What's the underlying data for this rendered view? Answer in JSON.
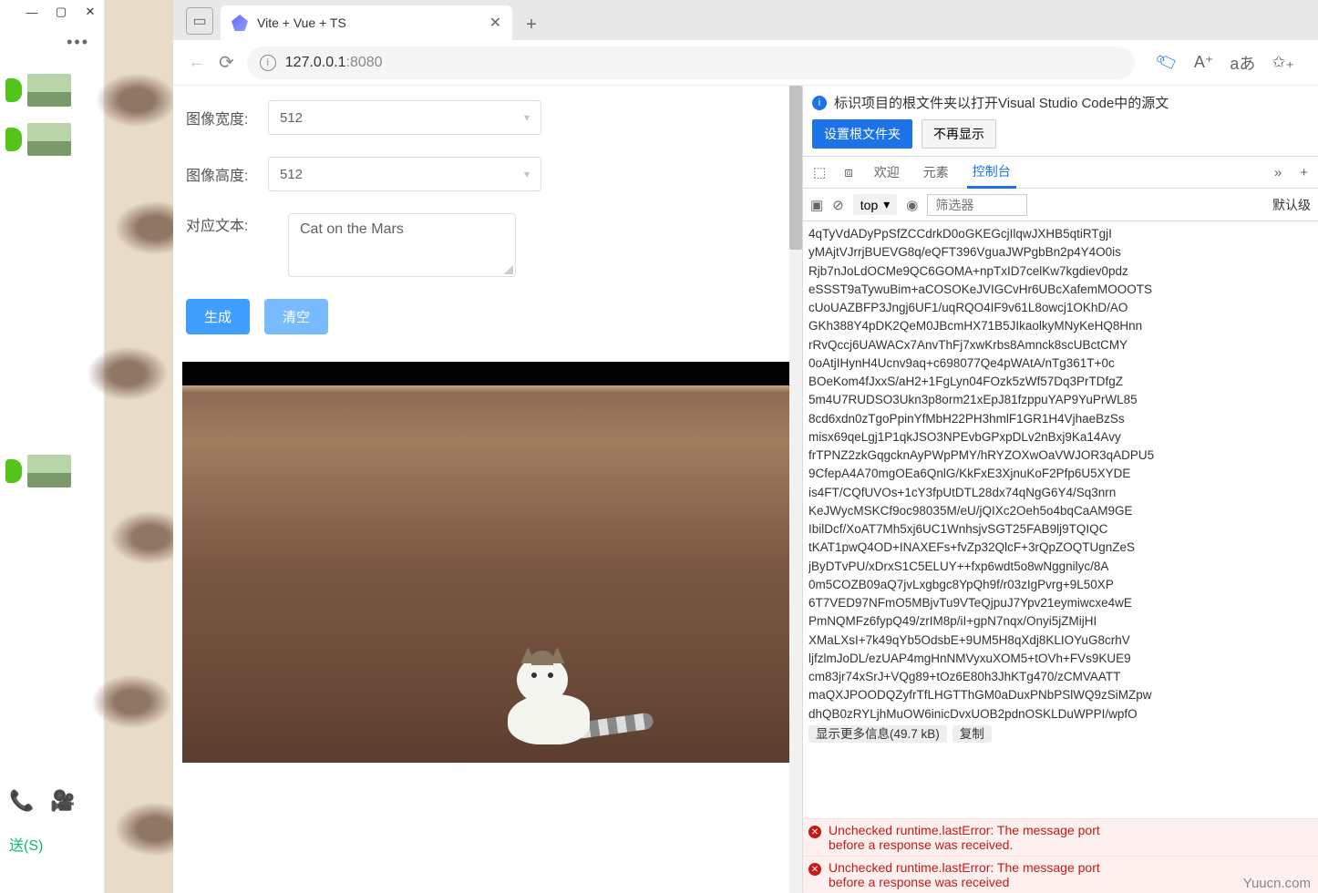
{
  "leftPanel": {
    "dotsMenu": "•••",
    "sendBtn": "送(S)"
  },
  "browser": {
    "tabTitle": "Vite + Vue + TS",
    "urlHost": "127.0.0.1",
    "urlPort": ":8080"
  },
  "form": {
    "widthLabel": "图像宽度:",
    "widthValue": "512",
    "heightLabel": "图像高度:",
    "heightValue": "512",
    "textLabel": "对应文本:",
    "textValue": "Cat on the Mars",
    "generateBtn": "生成",
    "clearBtn": "清空"
  },
  "devtools": {
    "bannerText": "标识项目的根文件夹以打开Visual Studio Code中的源文",
    "setRootBtn": "设置根文件夹",
    "dismissBtn": "不再显示",
    "tabs": {
      "welcome": "欢迎",
      "elements": "元素",
      "console": "控制台"
    },
    "context": "top",
    "filterPlaceholder": "筛选器",
    "levelLabel": "默认级",
    "consoleLines": [
      "4qTyVdADyPpSfZCCdrkD0oGKEGcjIlqwJXHB5qtiRTgjI",
      "yMAjtVJrrjBUEVG8q/eQFT396VguaJWPgbBn2p4Y4O0is",
      "Rjb7nJoLdOCMe9QC6GOMA+npTxID7celKw7kgdiev0pdz",
      "eSSST9aTywuBim+aCOSOKeJVIGCvHr6UBcXafemMOOOTS",
      "cUoUAZBFP3Jngj6UF1/uqRQO4IF9v61L8owcj1OKhD/AO",
      "GKh388Y4pDK2QeM0JBcmHX71B5JIkaolkyMNyKeHQ8Hnn",
      "rRvQccj6UAWACx7AnvThFj7xwKrbs8Amnck8scUBctCMY",
      "0oAtjIHynH4Ucnv9aq+c698077Qe4pWAtA/nTg361T+0c",
      "BOeKom4fJxxS/aH2+1FgLyn04FOzk5zWf57Dq3PrTDfgZ",
      "5m4U7RUDSO3Ukn3p8orm21xEpJ81fzppuYAP9YuPrWL85",
      "8cd6xdn0zTgoPpinYfMbH22PH3hmlF1GR1H4VjhaeBzSs",
      "misx69qeLgj1P1qkJSO3NPEvbGPxpDLv2nBxj9Ka14Avy",
      "frTPNZ2zkGqgcknAyPWpPMY/hRYZOXwOaVWJOR3qADPU5",
      "9CfepA4A70mgOEa6QnlG/KkFxE3XjnuKoF2Pfp6U5XYDE",
      "is4FT/CQfUVOs+1cY3fpUtDTL28dx74qNgG6Y4/Sq3nrn",
      "KeJWycMSKCf9oc98035M/eU/jQIXc2Oeh5o4bqCaAM9GE",
      "IbilDcf/XoAT7Mh5xj6UC1WnhsjvSGT25FAB9lj9TQIQC",
      "tKAT1pwQ4OD+INAXEFs+fvZp32QlcF+3rQpZOQTUgnZeS",
      "jByDTvPU/xDrxS1C5ELUY++fxp6wdt5o8wNggnilyc/8A",
      "0m5COZB09aQ7jvLxgbgc8YpQh9f/r03zIgPvrg+9L50XP",
      "6T7VED97NFmO5MBjvTu9VTeQjpuJ7Ypv21eymiwcxe4wE",
      "PmNQMFz6fypQ49/zrIM8p/iI+gpN7nqx/Onyi5jZMijHI",
      "XMaLXsI+7k49qYb5OdsbE+9UM5H8qXdj8KLIOYuG8crhV",
      "ljfzlmJoDL/ezUAP4mgHnNMVyxuXOM5+tOVh+FVs9KUE9",
      "cm83jr74xSrJ+VQg89+tOz6E80h3JhKTg470/zCMVAATT",
      "maQXJPOODQZyfrTfLHGTThGM0aDuxPNbPSlWQ9zSiMZpw",
      "dhQB0zRYLjhMuOW6inicDvxUOB2pdnOSKLDuWPPI/wpfO"
    ],
    "showMore": "显示更多信息(49.7 kB)",
    "copy": "复制",
    "error1": "Unchecked runtime.lastError: The message port\nbefore a response was received.",
    "error2": "Unchecked runtime.lastError: The message port\nbefore a response was received"
  },
  "watermark": "Yuucn.com"
}
